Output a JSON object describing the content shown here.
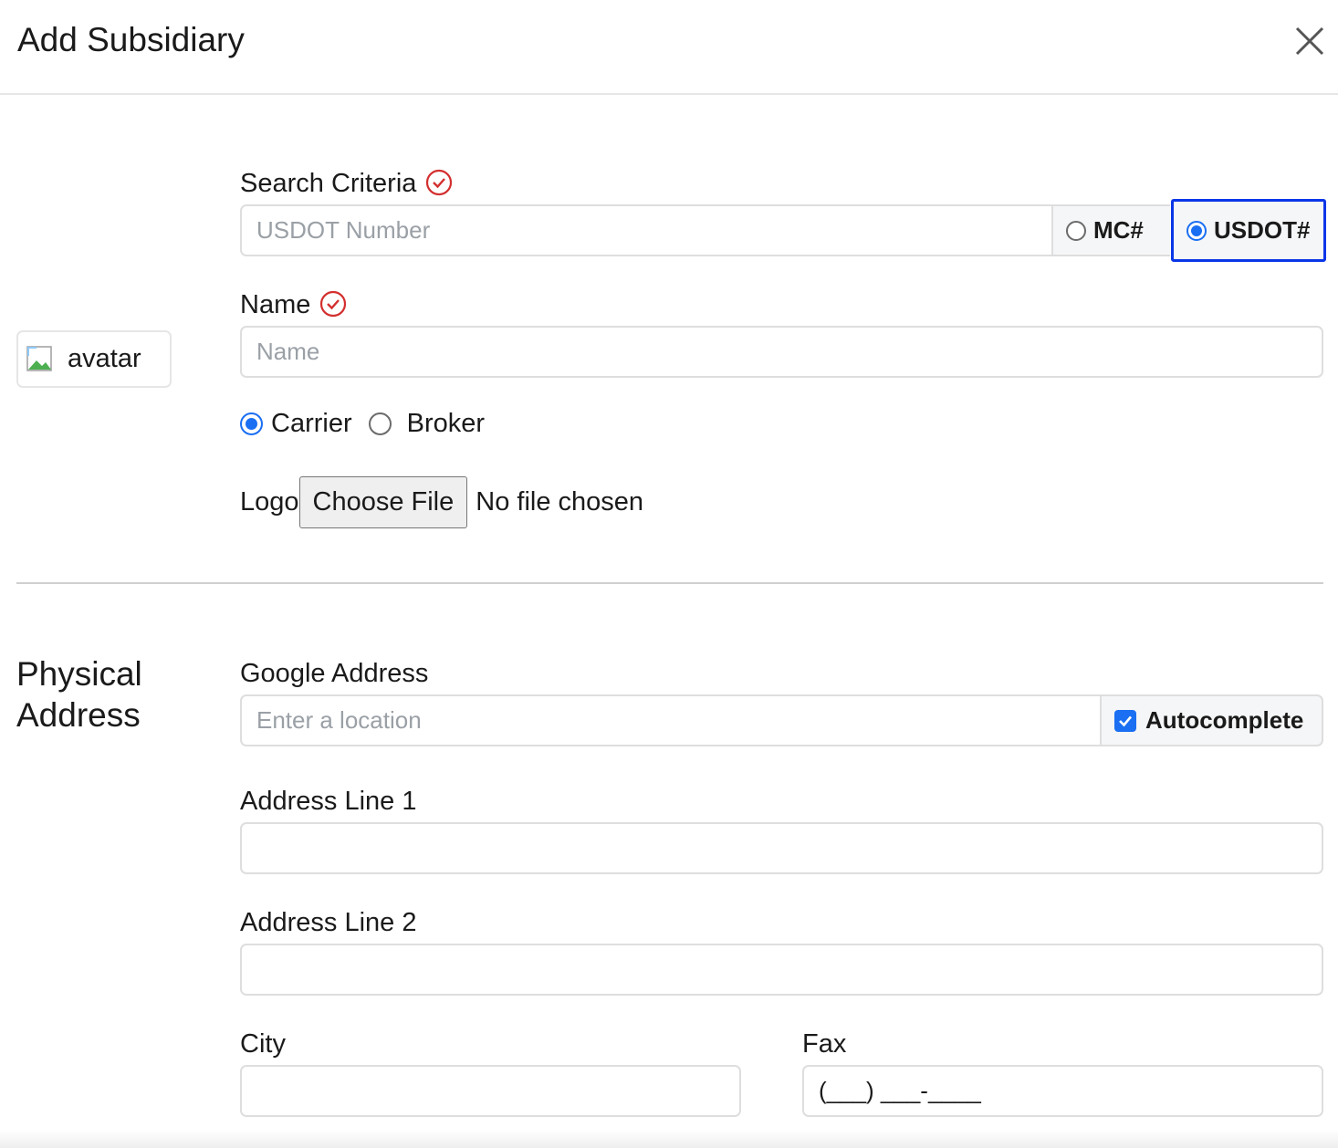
{
  "modal": {
    "title": "Add Subsidiary"
  },
  "search": {
    "label": "Search Criteria",
    "placeholder": "USDOT Number",
    "options": [
      {
        "label": "MC#",
        "selected": false
      },
      {
        "label": "USDOT#",
        "selected": true
      }
    ]
  },
  "name": {
    "label": "Name",
    "placeholder": "Name"
  },
  "avatar": {
    "alt": "avatar"
  },
  "entity_type": {
    "options": [
      {
        "label": "Carrier",
        "selected": true
      },
      {
        "label": "Broker",
        "selected": false
      }
    ]
  },
  "logo": {
    "label": "Logo",
    "button": "Choose File",
    "status": "No file chosen"
  },
  "physical_address": {
    "title": "Physical Address",
    "google": {
      "label": "Google Address",
      "placeholder": "Enter a location",
      "autocomplete_label": "Autocomplete",
      "autocomplete_checked": true
    },
    "line1": {
      "label": "Address Line 1",
      "value": ""
    },
    "line2": {
      "label": "Address Line 2",
      "value": ""
    },
    "city": {
      "label": "City",
      "value": ""
    },
    "fax": {
      "label": "Fax",
      "value": "(___) ___-____"
    }
  },
  "colors": {
    "accent": "#1a6ff2",
    "focus": "#0a36e8",
    "required": "#d32f2f"
  }
}
